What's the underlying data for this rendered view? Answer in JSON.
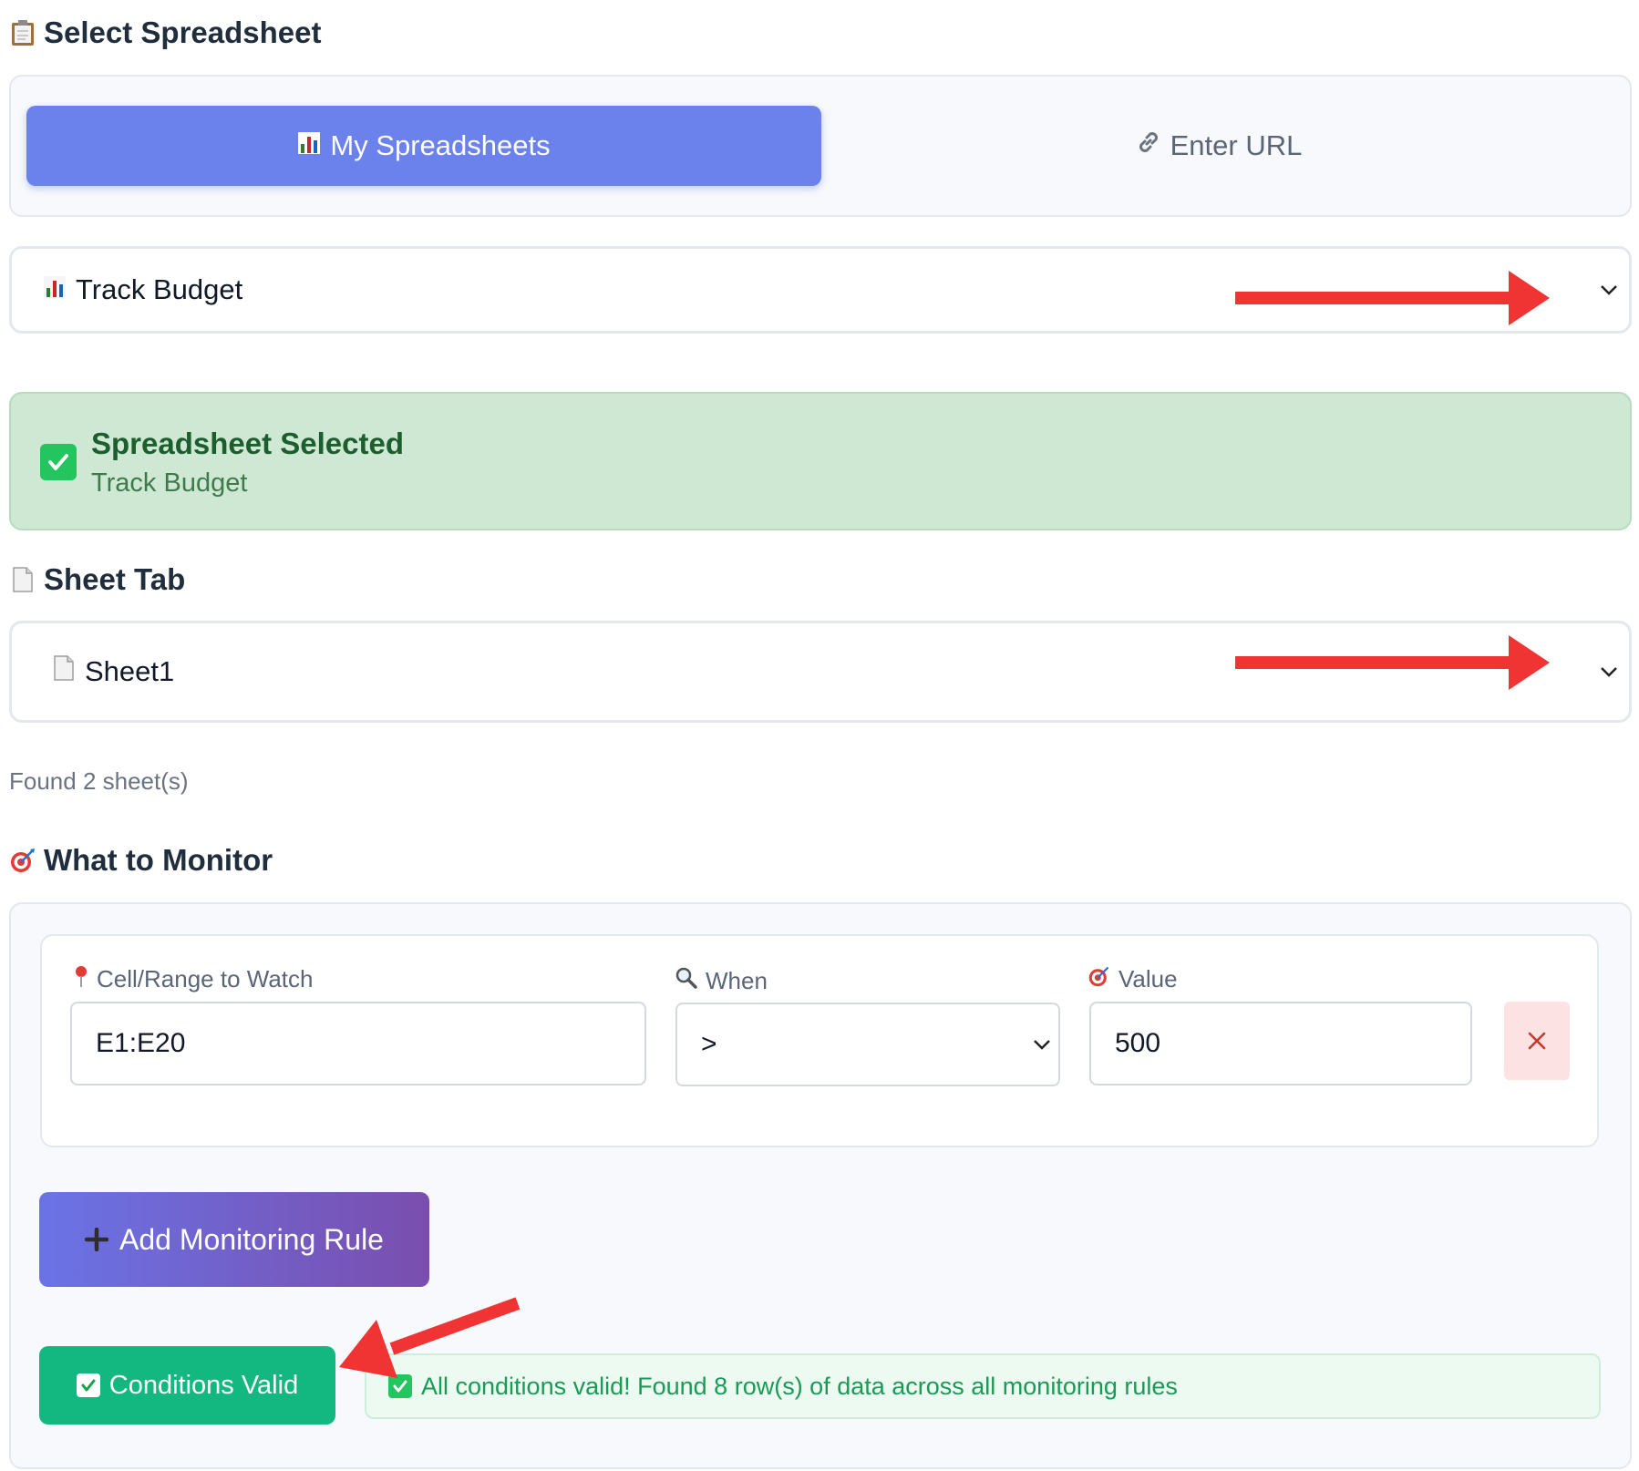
{
  "select_spreadsheet": {
    "heading": "Select Spreadsheet",
    "heading_icon": "clipboard-icon",
    "tabs": [
      {
        "label": "My Spreadsheets",
        "icon": "bar-chart-icon",
        "active": true
      },
      {
        "label": "Enter URL",
        "icon": "link-icon",
        "active": false
      }
    ],
    "selected": {
      "label": "Track Budget",
      "icon": "bar-chart-icon"
    }
  },
  "status": {
    "title": "Spreadsheet Selected",
    "subtitle": "Track Budget",
    "icon": "check-icon"
  },
  "sheet_tab": {
    "heading": "Sheet Tab",
    "heading_icon": "page-icon",
    "selected": {
      "label": "Sheet1",
      "icon": "page-icon"
    },
    "found_text": "Found 2 sheet(s)"
  },
  "monitor": {
    "heading": "What to Monitor",
    "heading_icon": "target-icon",
    "rule": {
      "cell_label": "Cell/Range to Watch",
      "cell_value": "E1:E20",
      "when_label": "When",
      "when_value": ">",
      "value_label": "Value",
      "value_value": "500"
    },
    "add_button": "Add Monitoring Rule",
    "valid_button": "Conditions Valid",
    "valid_message": "All conditions valid! Found 8 row(s) of data across all monitoring rules"
  },
  "colors": {
    "accent": "#6b82ec",
    "success": "#13b880",
    "annotation_arrow": "#f03434"
  }
}
